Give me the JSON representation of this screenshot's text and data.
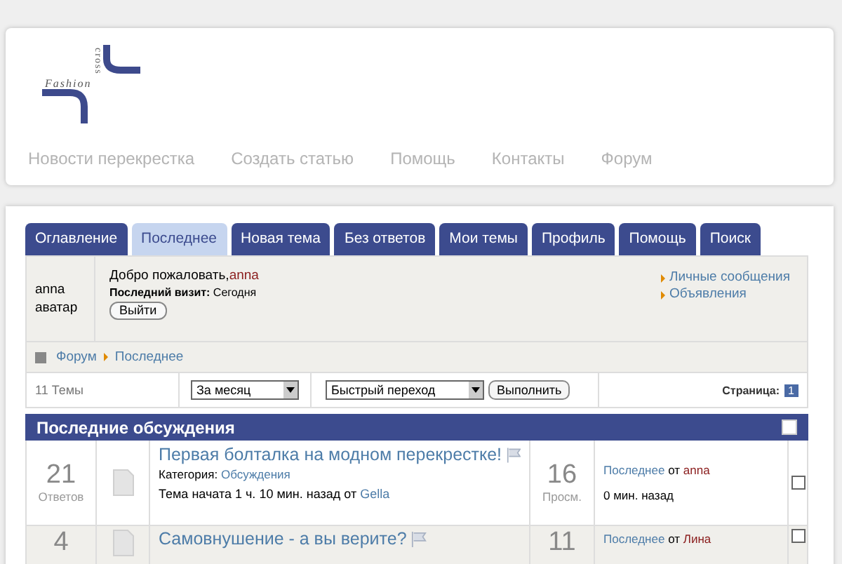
{
  "logo": {
    "word_1": "Fashion",
    "word_2": "cross"
  },
  "nav": [
    "Новости перекрестка",
    "Создать статью",
    "Помощь",
    "Контакты",
    "Форум"
  ],
  "tabs": [
    {
      "label": "Оглавление",
      "selected": false
    },
    {
      "label": "Последнее",
      "selected": true
    },
    {
      "label": "Новая тема",
      "selected": false
    },
    {
      "label": "Без ответов",
      "selected": false
    },
    {
      "label": "Мои темы",
      "selected": false
    },
    {
      "label": "Профиль",
      "selected": false
    },
    {
      "label": "Помощь",
      "selected": false
    },
    {
      "label": "Поиск",
      "selected": false
    }
  ],
  "user": {
    "name": "anna",
    "avatar": "аватар",
    "welcome": "Добро пожаловать,",
    "username": "anna",
    "last_visit": "**Последний визит:** Сегодня",
    "logout": "Выйти",
    "links": [
      "Личные сообщения",
      "Объявления"
    ]
  },
  "breadcrumb": [
    "Форум",
    "Последнее"
  ],
  "toolbar": {
    "count": "11 Темы",
    "period": "За месяц",
    "jump": "Быстрый переход",
    "go": "Выполнить",
    "page_label": "Страница:",
    "page": "1"
  },
  "section_title": "Последние обсуждения",
  "section_checked": false,
  "topics": [
    {
      "replies": "21",
      "replies_label": "Ответов",
      "title": "Первая болталка на модном перекрестке!",
      "category_label": "Категория:",
      "category": "Обсуждения",
      "started": "Тема начата 1 ч. 10 мин. назад от",
      "author": "Gella",
      "views": "16",
      "views_label": "Просм.",
      "last_link": "Последнее",
      "last_by": "от",
      "last_user": "anna",
      "last_time": "0 мин. назад",
      "checked": false
    },
    {
      "replies": "4",
      "title": "Самовнушение - а вы верите?",
      "views": "11",
      "last_link": "Последнее",
      "last_by": "от",
      "last_user": "Лина",
      "checked": false
    }
  ]
}
